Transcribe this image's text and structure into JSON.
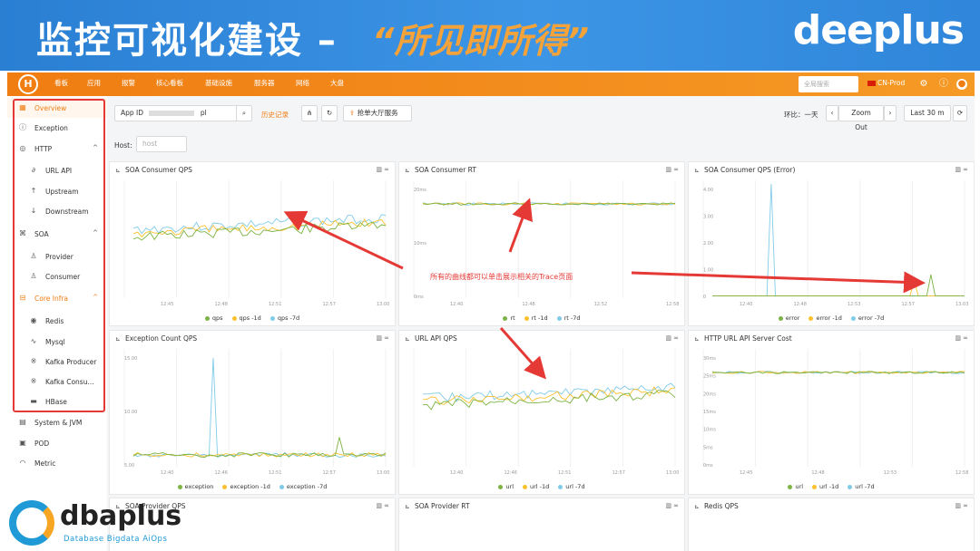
{
  "slide": {
    "title": "监控可视化建设 –",
    "subtitle": "“所见即所得”",
    "brand": "deeplus"
  },
  "topnav": {
    "logo": "H",
    "items": [
      "看板",
      "应用",
      "报警",
      "核心看板",
      "基础设施",
      "服务器",
      "网络",
      "大盘"
    ],
    "search_placeholder": "全局搜索",
    "env": "CN-Prod",
    "icons": [
      "settings-icon",
      "info-icon",
      "user-icon"
    ]
  },
  "sidebar": {
    "items": [
      {
        "label": "Overview",
        "icon": "grid-icon",
        "active": true
      },
      {
        "label": "Exception",
        "icon": "alert-icon"
      },
      {
        "label": "HTTP",
        "icon": "globe-icon",
        "caret": "^"
      },
      {
        "label": "URL API",
        "icon": "link-icon",
        "sub": true
      },
      {
        "label": "Upstream",
        "icon": "arrow-up-icon",
        "sub": true
      },
      {
        "label": "Downstream",
        "icon": "arrow-down-icon",
        "sub": true
      },
      {
        "label": "SOA",
        "icon": "command-icon",
        "caret": "^"
      },
      {
        "label": "Provider",
        "icon": "user-icon",
        "sub": true
      },
      {
        "label": "Consumer",
        "icon": "user-icon",
        "sub": true
      },
      {
        "label": "Core Infra",
        "icon": "stack-icon",
        "caret": "^",
        "open": true
      },
      {
        "label": "Redis",
        "icon": "database-icon",
        "sub": true
      },
      {
        "label": "Mysql",
        "icon": "dolphin-icon",
        "sub": true
      },
      {
        "label": "Kafka Producer",
        "icon": "kafka-icon",
        "sub": true
      },
      {
        "label": "Kafka Consu...",
        "icon": "kafka-icon",
        "sub": true
      },
      {
        "label": "HBase",
        "icon": "hbase-icon",
        "sub": true
      },
      {
        "label": "System & JVM",
        "icon": "server-icon"
      },
      {
        "label": "POD",
        "icon": "box-icon"
      },
      {
        "label": "Metric",
        "icon": "gauge-icon"
      }
    ]
  },
  "toolbar": {
    "appid_label": "App ID",
    "appid_value": "pl",
    "history": "历史记录",
    "share_label": "抢单大厅服务",
    "compare_label": "环比：",
    "compare_value": "一天",
    "zoom_out": "Zoom Out",
    "range": "Last 30 m",
    "host_label": "Host:",
    "host_placeholder": "host"
  },
  "annotation": "所有的曲线都可以单击展示相关的Trace页面",
  "panels": [
    {
      "title": "SOA Consumer QPS",
      "legend": [
        "qps",
        "qps -1d",
        "qps -7d"
      ],
      "xticks": [
        "12:45",
        "12:48",
        "12:51",
        "12:57",
        "13:00"
      ],
      "yticks": []
    },
    {
      "title": "SOA Consumer RT",
      "legend": [
        "rt",
        "rt -1d",
        "rt -7d"
      ],
      "xticks": [
        "12:40",
        "12:48",
        "12:52",
        "12:58"
      ],
      "yticks": [
        "20ms",
        "10ms",
        "0ms"
      ]
    },
    {
      "title": "SOA Consumer QPS (Error)",
      "legend": [
        "error",
        "error -1d",
        "error -7d"
      ],
      "xticks": [
        "12:40",
        "12:48",
        "12:53",
        "12:57",
        "13:03"
      ],
      "yticks": [
        "4.00",
        "3.00",
        "2.00",
        "1.00",
        "0"
      ]
    },
    {
      "title": "Exception Count QPS",
      "legend": [
        "exception",
        "exception -1d",
        "exception -7d"
      ],
      "xticks": [
        "12:40",
        "12:46",
        "12:51",
        "12:57",
        "13:00"
      ],
      "yticks": [
        "15.00",
        "10.00",
        "5.00"
      ]
    },
    {
      "title": "URL API QPS",
      "legend": [
        "url",
        "url -1d",
        "url -7d"
      ],
      "xticks": [
        "12:40",
        "12:46",
        "12:51",
        "12:57",
        "13:00"
      ],
      "yticks": []
    },
    {
      "title": "HTTP URL API Server Cost",
      "legend": [
        "url",
        "url -1d",
        "url -7d"
      ],
      "xticks": [
        "12:45",
        "12:48",
        "12:53",
        "12:58"
      ],
      "yticks": [
        "30ms",
        "25ms",
        "20ms",
        "15ms",
        "10ms",
        "5ms",
        "0ms"
      ]
    },
    {
      "title": "SOA Provider QPS",
      "legend": [],
      "xticks": [],
      "yticks": []
    },
    {
      "title": "SOA Provider RT",
      "legend": [],
      "xticks": [],
      "yticks": []
    },
    {
      "title": "Redis QPS",
      "legend": [],
      "xticks": [],
      "yticks": []
    }
  ],
  "series_colors": {
    "current": "#7cb342",
    "minus1d": "#fbc02d",
    "minus7d": "#80cbe8"
  },
  "watermark": {
    "name": "dbaplus",
    "tagline": "Database  Bigdata  AiOps"
  }
}
